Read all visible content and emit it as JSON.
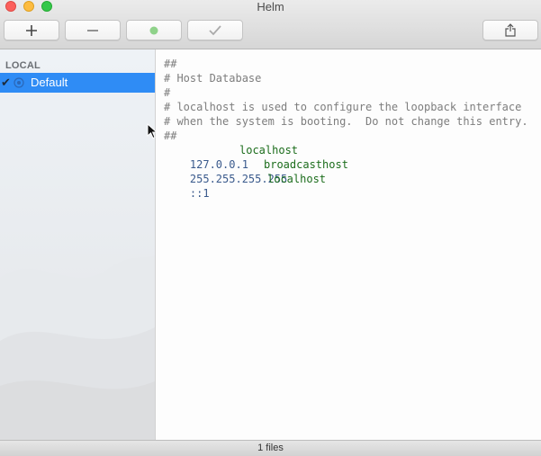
{
  "window": {
    "title": "Helm"
  },
  "toolbar": {
    "add_icon": "plus-icon",
    "remove_icon": "minus-icon",
    "status_icon": "green-dot-icon",
    "apply_icon": "checkmark-icon",
    "share_icon": "share-icon",
    "status_color": "#8fd28a"
  },
  "sidebar": {
    "section_label": "LOCAL",
    "items": [
      {
        "label": "Default",
        "selected": true,
        "checked": true
      }
    ],
    "selection_color": "#2f8cf5"
  },
  "editor": {
    "comment_lines": [
      "##",
      "# Host Database",
      "#",
      "# localhost is used to configure the loopback interface",
      "# when the system is booting.  Do not change this entry.",
      "##"
    ],
    "entries": [
      {
        "ip": "127.0.0.1",
        "host": "localhost"
      },
      {
        "ip": "255.255.255.255",
        "host": "broadcasthost"
      },
      {
        "ip": "::1",
        "host": "localhost"
      }
    ]
  },
  "status": {
    "text": "1 files"
  }
}
